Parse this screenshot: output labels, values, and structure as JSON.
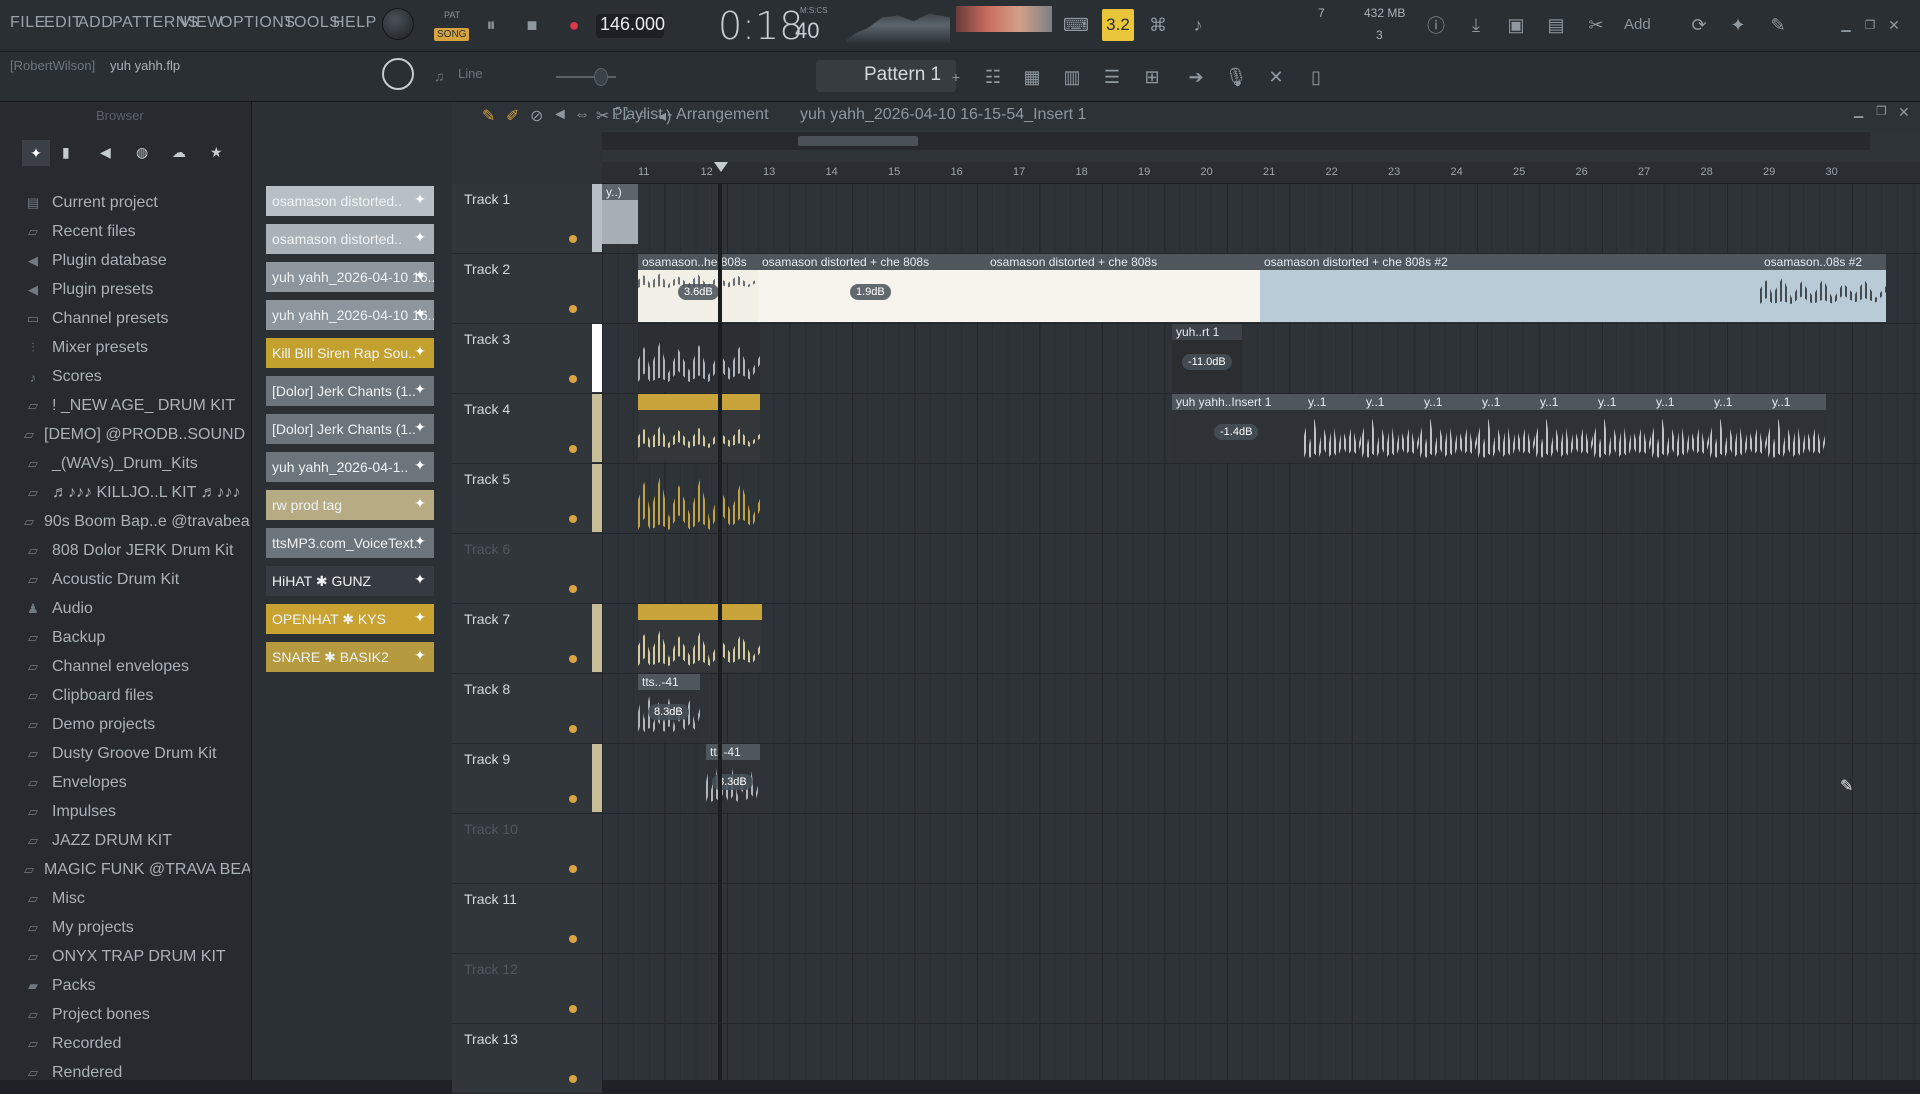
{
  "menu": [
    "FILE",
    "EDIT",
    "ADD",
    "PATTERNS",
    "VIEW",
    "OPTIONS",
    "TOOLS",
    "HELP"
  ],
  "transport": {
    "pat_label": "PAT",
    "song_label": "SONG",
    "tempo": "146.000",
    "time": "0:18",
    "time_sub": "40",
    "time_unit": "M:S:CS",
    "snap_display": "3.2",
    "cpu": "7",
    "ram": "432 MB",
    "poly": "3"
  },
  "add_label": "Add",
  "project": {
    "user": "[RobertWilson]",
    "file": "yuh yahh.flp"
  },
  "snap_mode": "Line",
  "pattern": "Pattern 1",
  "browser": {
    "title": "Browser",
    "items": [
      {
        "label": "Current project",
        "icon": "project-icon"
      },
      {
        "label": "Recent files",
        "icon": "folder-icon"
      },
      {
        "label": "Plugin database",
        "icon": "plugin-icon"
      },
      {
        "label": "Plugin presets",
        "icon": "plugin-icon"
      },
      {
        "label": "Channel presets",
        "icon": "channel-icon"
      },
      {
        "label": "Mixer presets",
        "icon": "mixer-icon"
      },
      {
        "label": "Scores",
        "icon": "note-icon"
      },
      {
        "label": "! _NEW AGE_ DRUM KIT",
        "icon": "folder-icon"
      },
      {
        "label": "[DEMO] @PRODB..SOUND KIT",
        "icon": "folder-icon"
      },
      {
        "label": "_(WAVs)_Drum_Kits",
        "icon": "folder-icon"
      },
      {
        "label": "♬♪♪♪ KILLJO..L KIT ♬♪♪♪",
        "icon": "folder-icon"
      },
      {
        "label": "90s Boom Bap..e @travabeats",
        "icon": "folder-icon"
      },
      {
        "label": "808 Dolor JERK Drum Kit",
        "icon": "folder-icon"
      },
      {
        "label": "Acoustic Drum Kit",
        "icon": "folder-icon"
      },
      {
        "label": "Audio",
        "icon": "audio-icon"
      },
      {
        "label": "Backup",
        "icon": "folder-icon"
      },
      {
        "label": "Channel envelopes",
        "icon": "folder-icon"
      },
      {
        "label": "Clipboard files",
        "icon": "folder-icon"
      },
      {
        "label": "Demo projects",
        "icon": "folder-icon"
      },
      {
        "label": "Dusty Groove Drum Kit",
        "icon": "folder-icon"
      },
      {
        "label": "Envelopes",
        "icon": "folder-icon"
      },
      {
        "label": "Impulses",
        "icon": "folder-icon"
      },
      {
        "label": "JAZZ DRUM KIT",
        "icon": "folder-icon"
      },
      {
        "label": "MAGIC FUNK @TRAVA BEATS",
        "icon": "folder-icon"
      },
      {
        "label": "Misc",
        "icon": "folder-icon"
      },
      {
        "label": "My projects",
        "icon": "folder-icon"
      },
      {
        "label": "ONYX TRAP DRUM KIT",
        "icon": "folder-icon"
      },
      {
        "label": "Packs",
        "icon": "packs-icon"
      },
      {
        "label": "Project bones",
        "icon": "folder-icon"
      },
      {
        "label": "Recorded",
        "icon": "folder-icon"
      },
      {
        "label": "Rendered",
        "icon": "folder-icon"
      }
    ]
  },
  "channels": [
    {
      "label": "osamason distorted..",
      "color": "#b9c0c5"
    },
    {
      "label": "osamason distorted..",
      "color": "#aab2b8"
    },
    {
      "label": "yuh yahh_2026-04-10 16..",
      "color": "#8d969d"
    },
    {
      "label": "yuh yahh_2026-04-10 16..",
      "color": "#8d969d"
    },
    {
      "label": "Kill Bill Siren Rap Sou..",
      "color": "#c2a12f"
    },
    {
      "label": "[Dolor] Jerk Chants (1..",
      "color": "#6c757b"
    },
    {
      "label": "[Dolor] Jerk Chants (1..",
      "color": "#6c757b"
    },
    {
      "label": "yuh yahh_2026-04-1..",
      "color": "#6c757b"
    },
    {
      "label": "rw prod tag",
      "color": "#b7ab84"
    },
    {
      "label": "ttsMP3.com_VoiceText..",
      "color": "#6c757b"
    },
    {
      "label": "HiHAT ✱ GUNZ",
      "color": "#353b40"
    },
    {
      "label": "OPENHAT ✱ KYS",
      "color": "#c8a332"
    },
    {
      "label": "SNARE ✱ BASIK2",
      "color": "#b59a3f"
    }
  ],
  "playlist": {
    "title": "Playlist - Arrangement",
    "breadcrumb": "yuh yahh_2026-04-10 16-15-54_Insert 1",
    "ruler": [
      "11",
      "12",
      "13",
      "14",
      "15",
      "16",
      "17",
      "18",
      "19",
      "20",
      "21",
      "22",
      "23",
      "24",
      "25",
      "26",
      "27",
      "28",
      "29",
      "30"
    ],
    "tracks": [
      {
        "name": "Track 1",
        "dim": false,
        "strip": "#b8c0c6"
      },
      {
        "name": "Track 2",
        "dim": false,
        "strip": ""
      },
      {
        "name": "Track 3",
        "dim": false,
        "strip": "#ffffff"
      },
      {
        "name": "Track 4",
        "dim": false,
        "strip": "#c7bd97"
      },
      {
        "name": "Track 5",
        "dim": false,
        "strip": "#c7bd97"
      },
      {
        "name": "Track 6",
        "dim": true,
        "strip": ""
      },
      {
        "name": "Track 7",
        "dim": false,
        "strip": "#c7bd97"
      },
      {
        "name": "Track 8",
        "dim": false,
        "strip": ""
      },
      {
        "name": "Track 9",
        "dim": false,
        "strip": "#c7bd97"
      },
      {
        "name": "Track 10",
        "dim": true,
        "strip": ""
      },
      {
        "name": "Track 11",
        "dim": false,
        "strip": ""
      },
      {
        "name": "Track 12",
        "dim": true,
        "strip": ""
      },
      {
        "name": "Track 13",
        "dim": false,
        "strip": ""
      }
    ],
    "clips": {
      "t1": "y..)",
      "t2a": "osamason..he 808s",
      "t2a_db": "3.6dB",
      "t2b": "osamason distorted + che 808s",
      "t2b_db": "1.9dB",
      "t2c": "osamason distorted + che 808s",
      "t2d": "osamason distorted + che 808s #2",
      "t2e": "osamason..08s #2",
      "t3": "yuh..rt 1",
      "t3_db": "-11.0dB",
      "t4": "yuh yahh..Insert 1",
      "t4_db": "-1.4dB",
      "t4s": "y..1",
      "t8": "tts..-41",
      "t8_db": "8.3dB",
      "t9": "tt..-41",
      "t9_db": "8.3dB"
    }
  }
}
